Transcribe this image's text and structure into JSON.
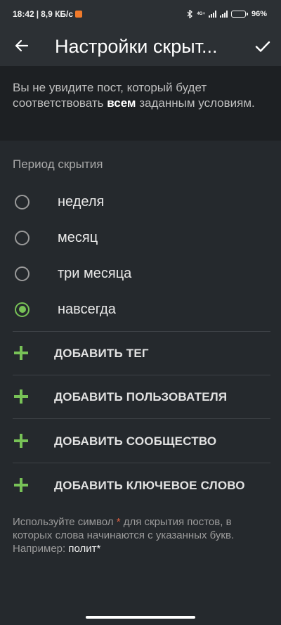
{
  "status_bar": {
    "time": "18:42",
    "separator": "|",
    "network_speed": "8,9 КБ/с",
    "network_type": "4G+",
    "battery": "96%",
    "battery_level": 0.96
  },
  "app_bar": {
    "title": "Настройки скрыт..."
  },
  "info": {
    "text_before": "Вы не увидите пост, который будет соответствовать ",
    "text_bold": "всем",
    "text_after": " заданным условиям."
  },
  "hide_period": {
    "title": "Период скрытия",
    "options": [
      {
        "label": "неделя",
        "checked": false
      },
      {
        "label": "месяц",
        "checked": false
      },
      {
        "label": "три месяца",
        "checked": false
      },
      {
        "label": "навсегда",
        "checked": true
      }
    ]
  },
  "actions": [
    {
      "label": "ДОБАВИТЬ ТЕГ"
    },
    {
      "label": "ДОБАВИТЬ ПОЛЬЗОВАТЕЛЯ"
    },
    {
      "label": "ДОБАВИТЬ СООБЩЕСТВО"
    },
    {
      "label": "ДОБАВИТЬ КЛЮЧЕВОЕ СЛОВО"
    }
  ],
  "hint": {
    "part1": "Используйте символ ",
    "star": "*",
    "part2": " для скрытия постов, в которых слова начинаются с указанных букв. Например: ",
    "example": "полит*"
  },
  "colors": {
    "accent": "#78c257",
    "background": "#25292d",
    "header": "#2c3034",
    "info_background": "#1d2023"
  }
}
